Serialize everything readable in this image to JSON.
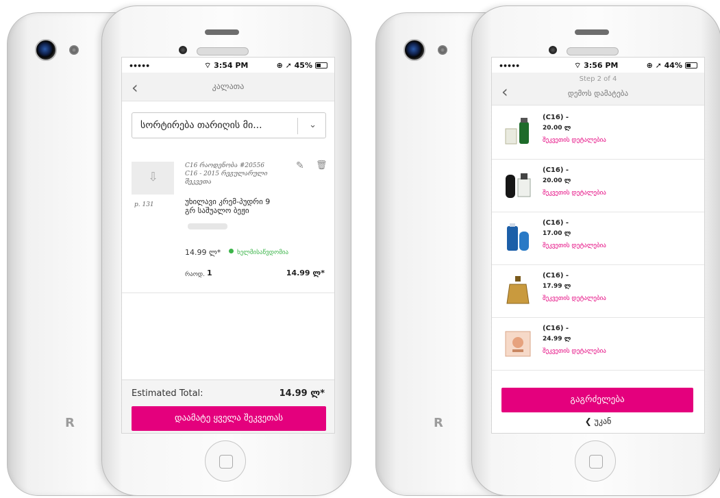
{
  "left_phone": {
    "status": {
      "signal": "•••••",
      "time": "3:54 PM",
      "battery": "45%",
      "battery_level": 0.45
    },
    "header": {
      "title": "კალათა"
    },
    "sort": {
      "label": "სორტირება თარიღის მი..."
    },
    "item": {
      "page_ref": "p. 131",
      "campaign_line1": "C16 რაოდენობა #20556",
      "campaign_line2": "C16 - 2015 რეგულარული შეკვეთა",
      "name_line1": "უხილავი კრემ-პუდრი 9",
      "name_line2": "გრ საშუალო ბეჟი",
      "price": "14.99 ლ*",
      "availability": "ხელმისაწვდომია",
      "qty_label": "რაოდ.",
      "qty": "1",
      "line_total": "14.99 ლ*"
    },
    "footer": {
      "estimated_label": "Estimated Total:",
      "estimated_value": "14.99 ლ*",
      "add_all_button": "დაამატე ყველა შეკვეთას"
    }
  },
  "right_phone": {
    "status": {
      "signal": "•••••",
      "time": "3:56 PM",
      "battery": "44%",
      "battery_level": 0.44
    },
    "header": {
      "step": "Step 2 of 4",
      "title": "დემოს დამატება"
    },
    "products": [
      {
        "title": "(C16) -",
        "price": "20.00 ლ",
        "link": "შეკვეთის დეტალებია",
        "image": "green-perfume-thumbnail"
      },
      {
        "title": "(C16) -",
        "price": "20.00 ლ",
        "link": "შეკვეთის დეტალებია",
        "image": "black-deodorant-thumbnail"
      },
      {
        "title": "(C16) -",
        "price": "17.00 ლ",
        "link": "შეკვეთის დეტალებია",
        "image": "blue-bottle-thumbnail"
      },
      {
        "title": "(C16) -",
        "price": "17.99 ლ",
        "link": "შეკვეთის დეტალებია",
        "image": "gold-perfume-thumbnail"
      },
      {
        "title": "(C16) -",
        "price": "24.99 ლ",
        "link": "შეკვეთის დეტალებია",
        "image": "pink-box-thumbnail"
      }
    ],
    "continue_button": "გაგრძელება",
    "back_link": "უკან"
  },
  "colors": {
    "accent": "#e4007d",
    "available": "#3cb44a"
  }
}
